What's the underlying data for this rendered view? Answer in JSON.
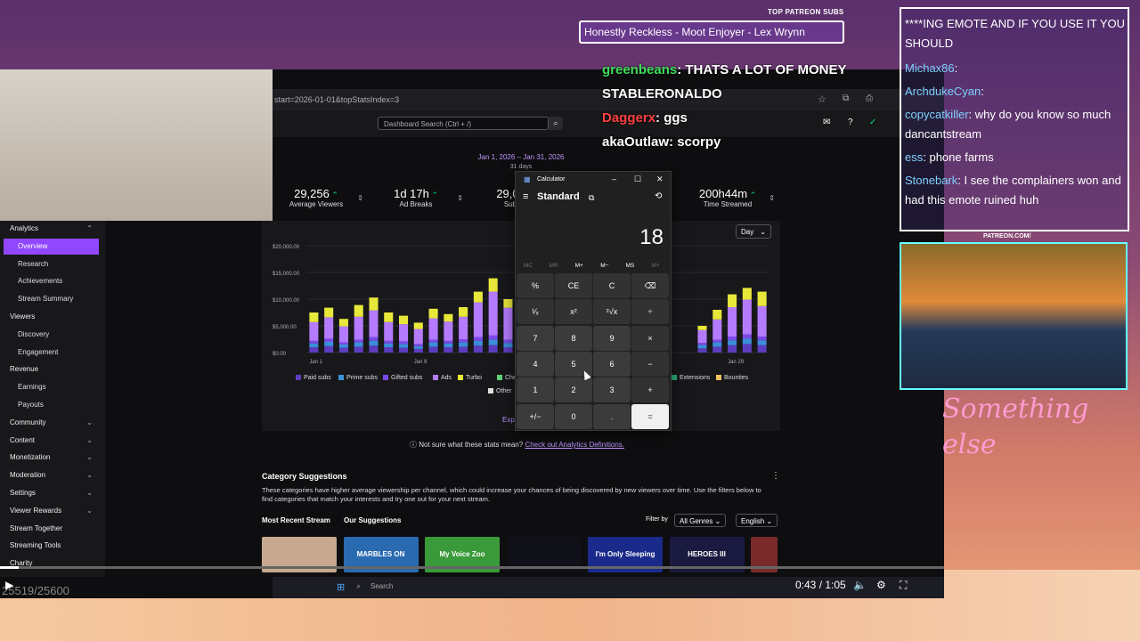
{
  "overlay": {
    "top_subs_label": "TOP PATREON SUBS",
    "top_subs_ticker": "Honestly Reckless - Moot Enjoyer - Lex Wrynn",
    "patreon_url": "PATREON.COM/",
    "signature": "Something else",
    "frame_counter": "25519/25600"
  },
  "stream_chat": [
    {
      "name": "",
      "text": "****ING EMOTE AND IF YOU USE IT YOU SHOULD"
    },
    {
      "name": "Michax86",
      "text": ":"
    },
    {
      "name": "ArchdukeCyan",
      "text": ":"
    },
    {
      "name": "copycatkiller",
      "text": ": why do you know so much  dancantstream"
    },
    {
      "name": "ess",
      "text": ": phone farms"
    },
    {
      "name": "Stonebark",
      "text": ": I see the complainers won and had this emote ruined huh"
    }
  ],
  "overlay_chat": [
    {
      "name": "greenbeans",
      "text": ": THATS A LOT OF MONEY",
      "color": "#3fdc5a"
    },
    {
      "name": "STABLERONALDO",
      "text": "",
      "color": "#ffffff"
    },
    {
      "name": "Daggerx",
      "text": ": ggs",
      "color": "#ff4040"
    },
    {
      "name": "akaOutlaw",
      "text": ": scorpy",
      "color": "#ffffff"
    }
  ],
  "browser": {
    "url_fragment": "start=2026-01-01&topStatsIndex=3"
  },
  "dashboard": {
    "search_placeholder": "Dashboard Search (Ctrl + /)",
    "date_range": "Jan 1, 2026 – Jan 31, 2026",
    "days_label": "31 days",
    "stats": [
      {
        "value": "29,256",
        "label": "Average Viewers"
      },
      {
        "value": "1d 17h",
        "label": "Ad Breaks"
      },
      {
        "value": "29,0",
        "label": "Subs"
      },
      {
        "value": "200h44m",
        "label": "Time Streamed"
      }
    ],
    "period_select": "Day",
    "not_sure_text": "Not sure what these stats mean?",
    "not_sure_link": "Check out Analytics Definitions.",
    "export_text": "Exp",
    "category_title": "Category Suggestions",
    "category_desc": "These categories have higher average viewership per channel, which could increase your chances of being discovered by new viewers over time. Use the filters below to find categories that match your interests and try one out for your next stream.",
    "tab_recent": "Most Recent Stream",
    "tab_suggestions": "Our Suggestions",
    "filter_by": "Filter by",
    "filter_genre": "All Genres",
    "filter_lang": "English",
    "tiles": [
      "",
      "MARBLES ON STREAM",
      "My Voice Zoo",
      "",
      "I'm Only Sleeping",
      "HEROES III",
      ""
    ]
  },
  "sidebar": {
    "items": [
      {
        "label": "Analytics",
        "type": "section",
        "chev": "⌃"
      },
      {
        "label": "Overview",
        "type": "active"
      },
      {
        "label": "Research",
        "type": "sub"
      },
      {
        "label": "Achievements",
        "type": "sub"
      },
      {
        "label": "Stream Summary",
        "type": "sub"
      },
      {
        "label": "Viewers",
        "type": "plain"
      },
      {
        "label": "Discovery",
        "type": "sub"
      },
      {
        "label": "Engagement",
        "type": "sub"
      },
      {
        "label": "Revenue",
        "type": "plain"
      },
      {
        "label": "Earnings",
        "type": "sub"
      },
      {
        "label": "Payouts",
        "type": "sub"
      },
      {
        "label": "Community",
        "type": "section",
        "chev": "⌄"
      },
      {
        "label": "Content",
        "type": "section",
        "chev": "⌄"
      },
      {
        "label": "Monetization",
        "type": "section",
        "chev": "⌄"
      },
      {
        "label": "Moderation",
        "type": "section",
        "chev": "⌄"
      },
      {
        "label": "Settings",
        "type": "section",
        "chev": "⌄"
      },
      {
        "label": "Viewer Rewards",
        "type": "section",
        "chev": "⌄"
      },
      {
        "label": "Stream Together",
        "type": "section"
      },
      {
        "label": "Streaming Tools",
        "type": "section"
      },
      {
        "label": "Charity",
        "type": "section"
      }
    ]
  },
  "calculator": {
    "title": "Calculator",
    "mode": "Standard",
    "display": "18",
    "memory": [
      "MC",
      "MR",
      "M+",
      "M−",
      "MS",
      "M˅"
    ],
    "keys": [
      [
        "%",
        "CE",
        "C",
        "⌫"
      ],
      [
        "¹⁄ₓ",
        "x²",
        "²√x",
        "÷"
      ],
      [
        "7",
        "8",
        "9",
        "×"
      ],
      [
        "4",
        "5",
        "6",
        "−"
      ],
      [
        "1",
        "2",
        "3",
        "+"
      ],
      [
        "+/−",
        "0",
        ".",
        "="
      ]
    ]
  },
  "player": {
    "timecode": "0:43 / 1:05",
    "taskbar_search": "Search",
    "progress_fraction": 0.02
  },
  "chart_data": {
    "type": "bar",
    "stacked": true,
    "x_tick_labels": [
      "Jan 1",
      "Jan 8",
      "Jan 29"
    ],
    "y_tick_labels": [
      "$20,000.00",
      "$15,000.00",
      "$10,000.00",
      "$5,000.00",
      "$0.00"
    ],
    "ylim": [
      0,
      20000
    ],
    "categories": [
      "1",
      "2",
      "3",
      "4",
      "5",
      "6",
      "7",
      "8",
      "9",
      "10",
      "11",
      "12",
      "13",
      "14",
      "15",
      "16",
      "17",
      "18",
      "19",
      "20",
      "21",
      "22",
      "23",
      "24",
      "25",
      "26",
      "27",
      "28",
      "29",
      "30",
      "31"
    ],
    "series": [
      {
        "name": "Paid subs",
        "color": "#5d3dbf",
        "values": [
          1000,
          1200,
          900,
          1100,
          1300,
          1000,
          900,
          700,
          1100,
          1000,
          1100,
          1300,
          1400,
          1000,
          0,
          0,
          0,
          0,
          0,
          0,
          0,
          0,
          0,
          0,
          0,
          0,
          800,
          1100,
          1400,
          1600,
          1400
        ]
      },
      {
        "name": "Prime subs",
        "color": "#3a8fd8",
        "values": [
          700,
          800,
          600,
          800,
          900,
          700,
          700,
          500,
          800,
          700,
          800,
          900,
          1000,
          800,
          0,
          0,
          0,
          0,
          0,
          0,
          0,
          0,
          0,
          0,
          0,
          0,
          600,
          800,
          900,
          1000,
          900
        ]
      },
      {
        "name": "Gifted subs",
        "color": "#7a4ae8",
        "values": [
          500,
          600,
          400,
          500,
          700,
          500,
          500,
          400,
          500,
          500,
          600,
          700,
          800,
          600,
          0,
          0,
          0,
          0,
          0,
          0,
          0,
          0,
          0,
          0,
          0,
          0,
          400,
          500,
          700,
          800,
          700
        ]
      },
      {
        "name": "Ads",
        "color": "#b57bff",
        "values": [
          3500,
          4000,
          3000,
          4300,
          5000,
          3500,
          3200,
          2800,
          4000,
          3600,
          4200,
          6500,
          8200,
          6000,
          0,
          0,
          0,
          0,
          0,
          0,
          0,
          0,
          0,
          0,
          0,
          0,
          2400,
          3800,
          5500,
          6500,
          5700
        ]
      },
      {
        "name": "Turbo",
        "color": "#e8e83a",
        "values": [
          1800,
          1800,
          1400,
          2200,
          2400,
          1800,
          1600,
          1200,
          1800,
          1400,
          1800,
          2000,
          2500,
          1600,
          0,
          0,
          0,
          0,
          0,
          0,
          0,
          0,
          0,
          0,
          0,
          0,
          800,
          1800,
          2400,
          2200,
          2700
        ]
      },
      {
        "name": "Cheers",
        "color": "#5fd17a",
        "values": [
          0,
          0,
          0,
          0,
          0,
          0,
          0,
          0,
          0,
          0,
          0,
          0,
          0,
          0,
          0,
          0,
          0,
          0,
          0,
          0,
          0,
          0,
          0,
          0,
          0,
          0,
          0,
          0,
          0,
          0,
          0
        ]
      },
      {
        "name": "Extensions",
        "color": "#2bb37a",
        "values": [
          0,
          0,
          0,
          0,
          0,
          0,
          0,
          0,
          0,
          0,
          0,
          0,
          0,
          0,
          0,
          0,
          0,
          0,
          0,
          0,
          0,
          0,
          0,
          0,
          0,
          0,
          0,
          0,
          0,
          0,
          0
        ]
      },
      {
        "name": "Bounties",
        "color": "#f0c060",
        "values": [
          0,
          0,
          0,
          0,
          0,
          0,
          0,
          0,
          0,
          0,
          0,
          0,
          0,
          0,
          0,
          0,
          0,
          0,
          0,
          0,
          0,
          0,
          0,
          0,
          0,
          0,
          0,
          0,
          0,
          0,
          0
        ]
      },
      {
        "name": "Other",
        "color": "#e0e0e0",
        "values": [
          0,
          0,
          0,
          0,
          0,
          0,
          0,
          0,
          0,
          0,
          0,
          0,
          0,
          0,
          0,
          0,
          0,
          0,
          0,
          0,
          0,
          0,
          0,
          0,
          0,
          0,
          0,
          0,
          0,
          0,
          0
        ]
      }
    ],
    "legend_visible": [
      "Paid subs",
      "Prime subs",
      "Gifted subs",
      "Ads",
      "Turbo",
      "Chee",
      "Extensions",
      "Bounties",
      "Other"
    ]
  }
}
